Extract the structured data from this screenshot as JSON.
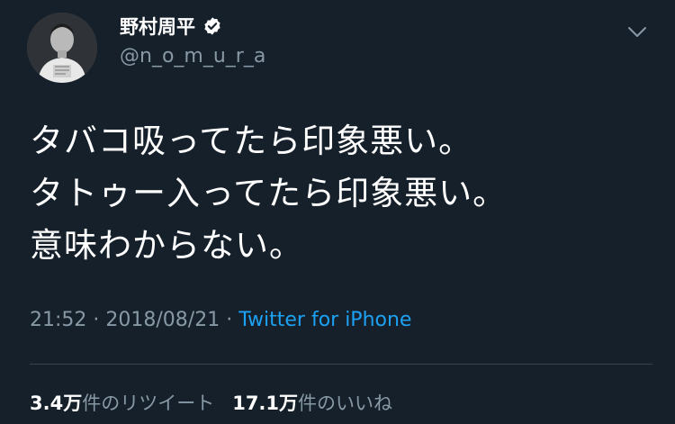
{
  "user": {
    "display_name": "野村周平",
    "handle": "@n_o_m_u_r_a",
    "verified": true
  },
  "tweet": {
    "lines": [
      "タバコ吸ってたら印象悪い。",
      "タトゥー入ってたら印象悪い。",
      "意味わからない。"
    ]
  },
  "meta": {
    "time": "21:52",
    "separator": "·",
    "date": "2018/08/21",
    "source": "Twitter for iPhone"
  },
  "stats": {
    "retweets_count": "3.4万",
    "retweets_label": "件のリツイート",
    "likes_count": "17.1万",
    "likes_label": "件のいいね"
  },
  "icons": {
    "verified": "verified-badge-icon",
    "menu": "chevron-down-icon"
  },
  "colors": {
    "background": "#15202b",
    "text": "#ffffff",
    "muted": "#8899a6",
    "link": "#1da1f2",
    "divider": "#38444d"
  }
}
